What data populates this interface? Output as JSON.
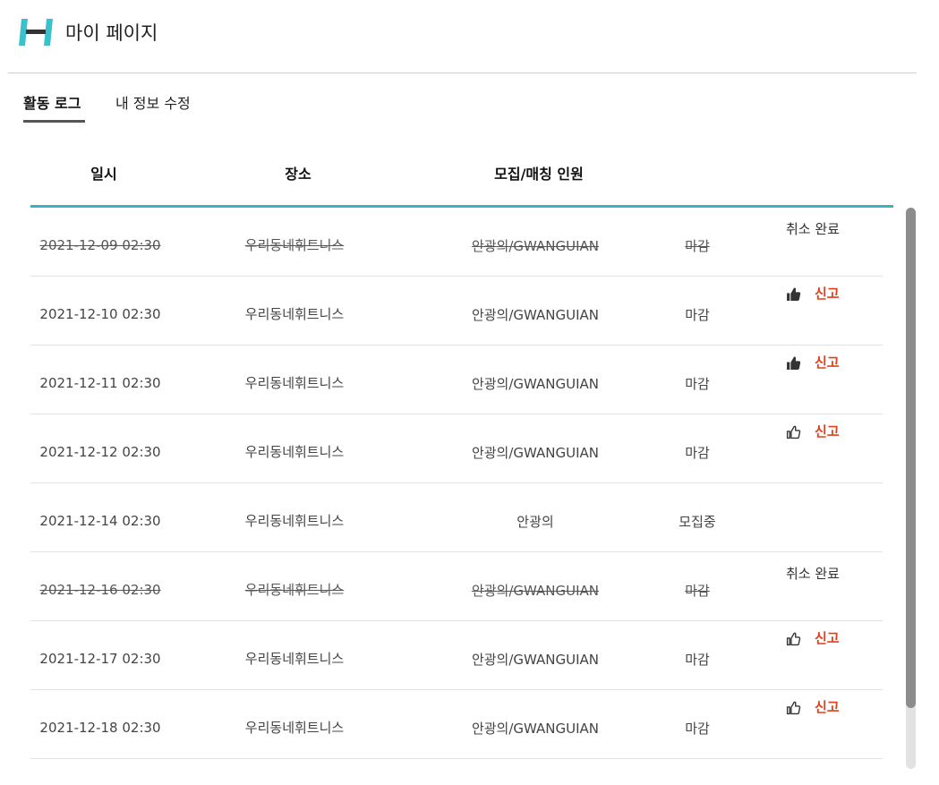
{
  "header": {
    "logo_icon": "h-brand-logo",
    "title": "마이 페이지",
    "brand_color": "#3ac2cc"
  },
  "tabs": [
    {
      "label": "활동 로그",
      "active": true
    },
    {
      "label": "내 정보 수정",
      "active": false
    }
  ],
  "table": {
    "columns": [
      "일시",
      "장소",
      "모집/매칭 인원",
      "",
      ""
    ],
    "accent_color": "#3ab3bc",
    "rows": [
      {
        "date": "2021-12-09 02:30",
        "place": "우리동네휘트니스",
        "people": "안광의/GWANGUIAN",
        "status": "마감",
        "cancelled": true,
        "action_text": "취소 완료"
      },
      {
        "date": "2021-12-10 02:30",
        "place": "우리동네휘트니스",
        "people": "안광의/GWANGUIAN",
        "status": "마감",
        "cancelled": false,
        "thumb_icon": "thumbs-up-filled-icon",
        "report_label": "신고"
      },
      {
        "date": "2021-12-11 02:30",
        "place": "우리동네휘트니스",
        "people": "안광의/GWANGUIAN",
        "status": "마감",
        "cancelled": false,
        "thumb_icon": "thumbs-up-filled-icon",
        "report_label": "신고"
      },
      {
        "date": "2021-12-12 02:30",
        "place": "우리동네휘트니스",
        "people": "안광의/GWANGUIAN",
        "status": "마감",
        "cancelled": false,
        "thumb_icon": "thumbs-up-outline-icon",
        "report_label": "신고"
      },
      {
        "date": "2021-12-14 02:30",
        "place": "우리동네휘트니스",
        "people": "안광의",
        "status": "모집중",
        "cancelled": false
      },
      {
        "date": "2021-12-16 02:30",
        "place": "우리동네휘트니스",
        "people": "안광의/GWANGUIAN",
        "status": "마감",
        "cancelled": true,
        "action_text": "취소 완료"
      },
      {
        "date": "2021-12-17 02:30",
        "place": "우리동네휘트니스",
        "people": "안광의/GWANGUIAN",
        "status": "마감",
        "cancelled": false,
        "thumb_icon": "thumbs-up-outline-icon",
        "report_label": "신고"
      },
      {
        "date": "2021-12-18 02:30",
        "place": "우리동네휘트니스",
        "people": "안광의/GWANGUIAN",
        "status": "마감",
        "cancelled": false,
        "thumb_icon": "thumbs-up-outline-icon",
        "report_label": "신고"
      }
    ]
  },
  "report_color": "#e0401e"
}
